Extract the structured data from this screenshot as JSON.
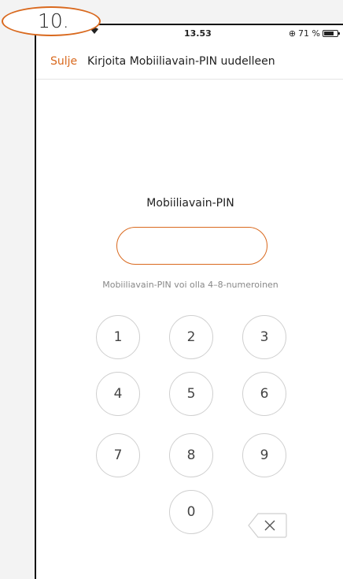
{
  "annotation": {
    "step": "10."
  },
  "statusbar": {
    "time": "13.53",
    "battery_percent": "71 %"
  },
  "navbar": {
    "close_label": "Sulje",
    "title": "Kirjoita Mobiiliavain-PIN uudelleen"
  },
  "pin": {
    "label": "Mobiiliavain-PIN",
    "value": "",
    "hint": "Mobiiliavain-PIN voi olla 4–8-numeroinen"
  },
  "keypad": {
    "keys": [
      "1",
      "2",
      "3",
      "4",
      "5",
      "6",
      "7",
      "8",
      "9",
      "0"
    ],
    "backspace_icon": "backspace-icon"
  },
  "colors": {
    "accent": "#d9691e"
  }
}
